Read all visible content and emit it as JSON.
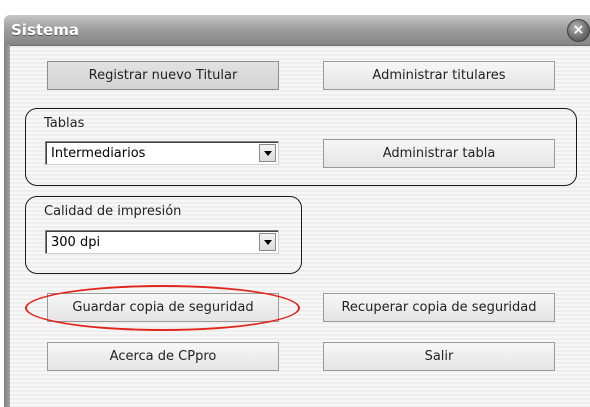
{
  "window": {
    "title": "Sistema"
  },
  "buttons": {
    "register_holder": "Registrar nuevo Titular",
    "manage_holders": "Administrar titulares",
    "manage_table": "Administrar tabla",
    "save_backup": "Guardar copia de seguridad",
    "restore_backup": "Recuperar copia de seguridad",
    "about": "Acerca de CPpro",
    "exit": "Salir"
  },
  "tables_group": {
    "label": "Tablas",
    "selected": "Intermediarios"
  },
  "print_group": {
    "label": "Calidad de impresión",
    "selected": "300 dpi"
  },
  "colors": {
    "highlight": "#e0261b",
    "titlebar": "#9f9f9f"
  }
}
